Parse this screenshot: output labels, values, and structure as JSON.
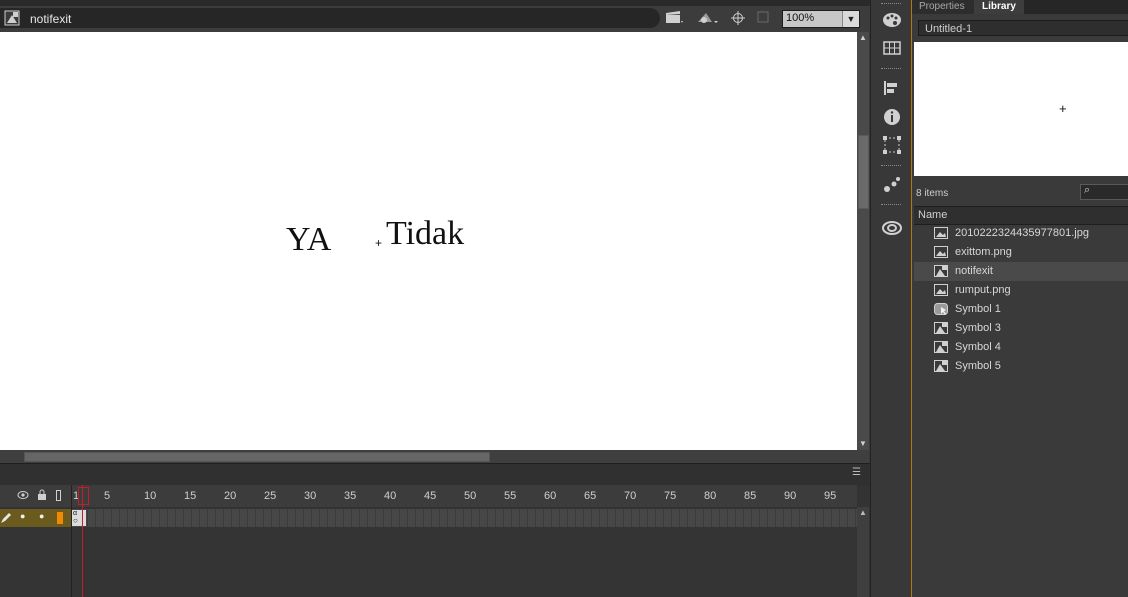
{
  "edit_bar": {
    "scene_name": "notifexit",
    "icon_clapper": "clapper-icon",
    "icon_symbol": "symbol-edit-icon",
    "icon_center": "center-stage-icon",
    "icon_clip": "clip-icon",
    "zoom": "100%"
  },
  "stage": {
    "label_left": "YA",
    "label_right": "Tidak",
    "registration_mark": "+"
  },
  "timeline": {
    "frame_numbers": [
      "1",
      "5",
      "10",
      "15",
      "20",
      "25",
      "30",
      "35",
      "40",
      "45",
      "50",
      "55",
      "60",
      "65",
      "70",
      "75",
      "80",
      "85",
      "90",
      "95"
    ],
    "icons": [
      "eye-icon",
      "lock-icon",
      "outline-icon",
      "pencil-icon"
    ],
    "current_frame": 1
  },
  "tools": {
    "items": [
      "color-palette-icon",
      "grid-icon",
      "align-icon",
      "info-icon",
      "transform-icon",
      "share-icon",
      "creative-cloud-icon"
    ]
  },
  "panel": {
    "tabs": [
      "Properties",
      "Library"
    ],
    "active_tab": "Library",
    "document": "Untitled-1",
    "preview_mark": "+",
    "item_count": "8 items",
    "column_name": "Name",
    "items": [
      {
        "label": "2010222324435977801.jpg",
        "icon": "bitmap-icon"
      },
      {
        "label": "exittom.png",
        "icon": "bitmap-icon"
      },
      {
        "label": "notifexit",
        "icon": "movieclip-icon"
      },
      {
        "label": "rumput.png",
        "icon": "bitmap-icon"
      },
      {
        "label": "Symbol 1",
        "icon": "button-symbol-icon"
      },
      {
        "label": "Symbol 3",
        "icon": "movieclip-icon"
      },
      {
        "label": "Symbol 4",
        "icon": "movieclip-icon"
      },
      {
        "label": "Symbol 5",
        "icon": "movieclip-icon"
      }
    ],
    "selected_index": 2
  },
  "colors": {
    "accent_orange": "#b5780e",
    "playhead_red": "#c0202a",
    "layer_highlight": "#6b5a1e"
  }
}
